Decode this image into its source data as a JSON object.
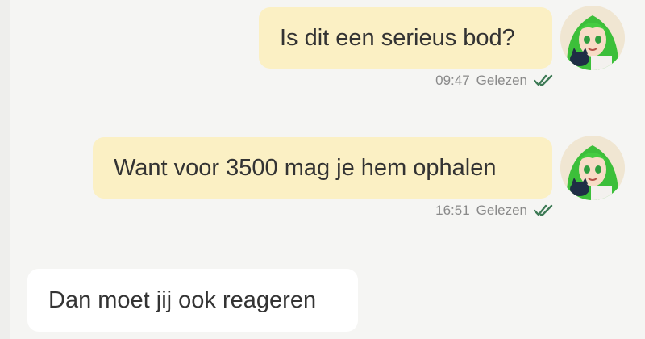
{
  "messages": [
    {
      "direction": "outgoing",
      "text": "Is dit een serieus bod?",
      "time": "09:47",
      "status": "Gelezen",
      "status_icon": "double-check-icon",
      "avatar": "anime-girl-avatar"
    },
    {
      "direction": "outgoing",
      "text": "Want voor 3500 mag je hem ophalen",
      "time": "16:51",
      "status": "Gelezen",
      "status_icon": "double-check-icon",
      "avatar": "anime-girl-avatar"
    },
    {
      "direction": "incoming",
      "text": "Dan moet jij ook reageren"
    }
  ],
  "colors": {
    "background": "#f5f5f3",
    "outgoing_bubble": "#fbf0c4",
    "incoming_bubble": "#ffffff",
    "read_check": "#3d7a55",
    "meta_text": "#8a8a8a"
  }
}
